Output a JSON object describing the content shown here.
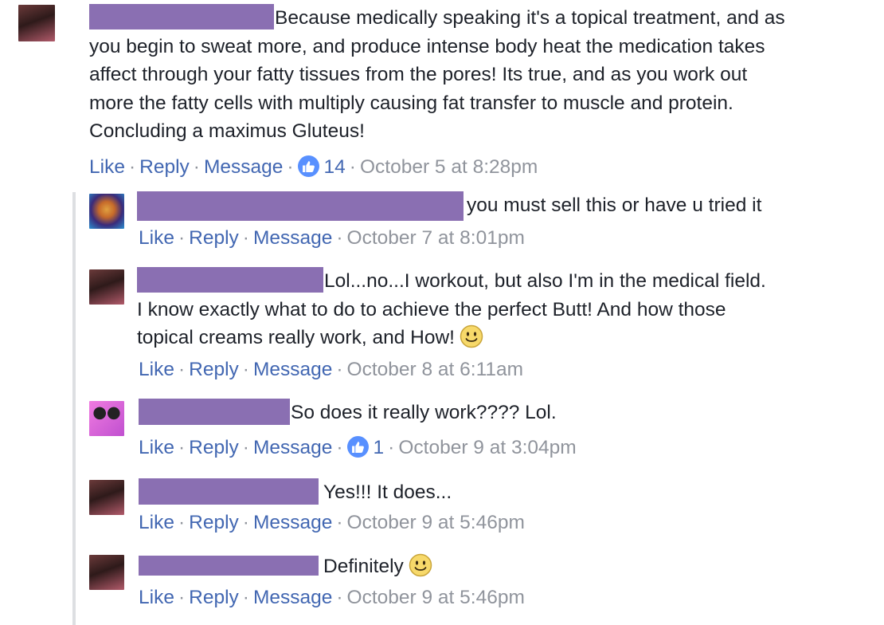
{
  "actions": {
    "like": "Like",
    "reply": "Reply",
    "message": "Message",
    "dot": "·"
  },
  "comments": [
    {
      "lines": [
        "Because medically speaking it's a topical treatment, and as",
        "you begin to sweat more, and produce intense body heat the medication takes",
        "affect through your fatty tissues from the pores! Its true, and as you work out",
        "more the fatty cells with multiply causing fat transfer to muscle and protein.",
        "Concluding a maximus Gluteus!"
      ],
      "likes": "14",
      "timestamp": "October 5 at 8:28pm"
    },
    {
      "lines": [
        "you must sell this or have u tried it"
      ],
      "timestamp": "October 7 at 8:01pm"
    },
    {
      "lines": [
        "Lol...no...I workout, but also I'm in the medical field.",
        "I know exactly what to do to achieve the perfect Butt! And how those",
        "topical creams really work, and How!"
      ],
      "emoji": "smile-emoji",
      "timestamp": "October 8 at 6:11am"
    },
    {
      "lines": [
        "So does it really work???? Lol."
      ],
      "likes": "1",
      "timestamp": "October 9 at 3:04pm"
    },
    {
      "lines": [
        "Yes!!! It does..."
      ],
      "timestamp": "October 9 at 5:46pm"
    },
    {
      "lines": [
        "Definitely"
      ],
      "emoji": "smile-emoji",
      "timestamp": "October 9 at 5:46pm"
    }
  ],
  "colors": {
    "link": "#4267b2",
    "meta": "#90949c",
    "redaction": "#8a6fb2",
    "like_badge": "#5890ff"
  }
}
